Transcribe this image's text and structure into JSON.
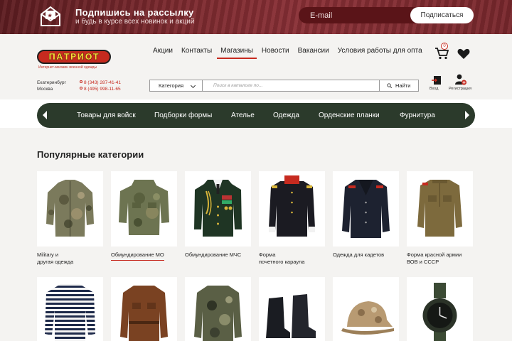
{
  "banner": {
    "title": "Подпишись на рассылку",
    "subtitle": "и будь в курсе всех новинок и акций",
    "email_placeholder": "E-mail",
    "subscribe_label": "Подписаться",
    "icon": "mail-icon"
  },
  "header": {
    "logo_text": "ПАТРИОТ",
    "logo_tagline": "Интернет-магазин военной одежды",
    "nav": [
      {
        "label": "Акции"
      },
      {
        "label": "Контакты"
      },
      {
        "label": "Магазины",
        "active": true
      },
      {
        "label": "Новости"
      },
      {
        "label": "Вакансии"
      },
      {
        "label": "Условия работы для опта"
      }
    ],
    "cart_count": "0",
    "cities": [
      "Екатеринбург",
      "Москва"
    ],
    "phones": [
      "8 (343) 287-41-41",
      "8 (495) 998-11-65"
    ],
    "search": {
      "category_label": "Категория",
      "placeholder": "Поиск в каталоге по...",
      "button_label": "Найти"
    },
    "login_label": "Вход",
    "register_label": "Регистрация"
  },
  "catbar": {
    "items": [
      {
        "label": "Товары для войск"
      },
      {
        "label": "Подборки формы"
      },
      {
        "label": "Ателье"
      },
      {
        "label": "Одежда"
      },
      {
        "label": "Орденские планки"
      },
      {
        "label": "Фурнитура"
      }
    ]
  },
  "section": {
    "title": "Популярные категории",
    "cards": [
      {
        "label_line1": "Military и",
        "label_line2": "другая одежда"
      },
      {
        "label_line1": "Обмундирование МО",
        "label_line2": ""
      },
      {
        "label_line1": "Обмундирование МЧС",
        "label_line2": ""
      },
      {
        "label_line1": "Форма",
        "label_line2": "почетного караула"
      },
      {
        "label_line1": "Одежда для кадетов",
        "label_line2": ""
      },
      {
        "label_line1": "Форма красной армии",
        "label_line2": "ВОВ и СССР"
      }
    ]
  },
  "colors": {
    "accent": "#c62a1f",
    "catbar": "#2b3a2b",
    "banner": "#7d2a2f"
  }
}
